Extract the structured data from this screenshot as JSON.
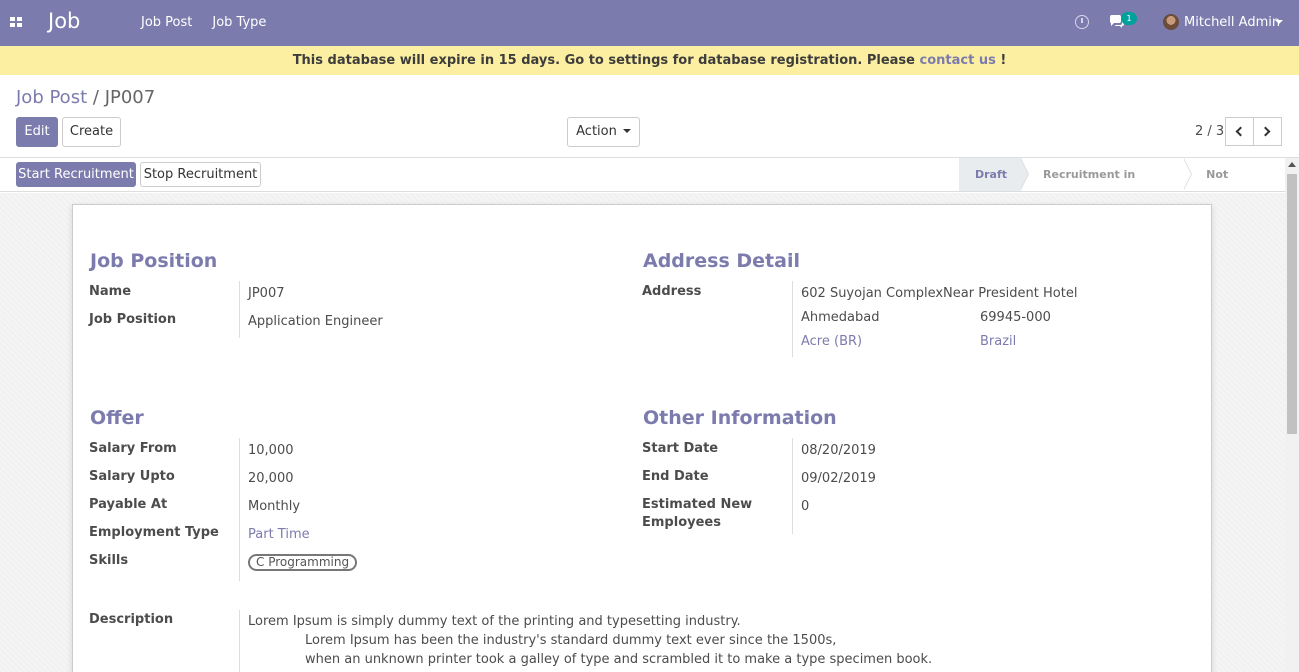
{
  "navbar": {
    "app_title": "Job",
    "menu": [
      "Job Post",
      "Job Type"
    ],
    "chat_count": "1",
    "user_name": "Mitchell Admin"
  },
  "banner": {
    "text": "This database will expire in 15 days. Go to settings for database registration. Please ",
    "link": "contact us",
    "suffix": " !"
  },
  "breadcrumb": {
    "parent": "Job Post",
    "separator": "/",
    "current": "JP007"
  },
  "toolbar": {
    "edit": "Edit",
    "create": "Create",
    "action": "Action"
  },
  "pager": {
    "value": "2 / 3"
  },
  "statusbar": {
    "buttons": [
      "Start Recruitment",
      "Stop Recruitment"
    ],
    "steps": [
      "Draft",
      "Recruitment in Progress",
      "Not Recruiting"
    ],
    "active_step": "Draft"
  },
  "job_position": {
    "title": "Job Position",
    "fields": [
      {
        "label": "Name",
        "value": "JP007"
      },
      {
        "label": "Job Position",
        "value": "Application Engineer"
      }
    ]
  },
  "address": {
    "title": "Address Detail",
    "label": "Address",
    "street": "602 Suyojan ComplexNear President Hotel",
    "city": "Ahmedabad",
    "zip": "69945-000",
    "state": "Acre (BR)",
    "country": "Brazil"
  },
  "offer": {
    "title": "Offer",
    "fields": [
      {
        "label": "Salary From",
        "value": "10,000"
      },
      {
        "label": "Salary Upto",
        "value": "20,000"
      },
      {
        "label": "Payable At",
        "value": "Monthly"
      },
      {
        "label": "Employment Type",
        "value": "Part Time"
      },
      {
        "label": "Skills",
        "value": "C Programming"
      }
    ]
  },
  "other_info": {
    "title": "Other Information",
    "fields": [
      {
        "label": "Start Date",
        "value": "08/20/2019"
      },
      {
        "label": "End Date",
        "value": "09/02/2019"
      },
      {
        "label_line1": "Estimated New",
        "label_line2": "Employees",
        "value": "0"
      }
    ]
  },
  "description": {
    "label": "Description",
    "lines": [
      "Lorem Ipsum is simply dummy text of the printing and typesetting industry.",
      "Lorem Ipsum has been the industry's standard dummy text ever since the 1500s,",
      "when an unknown printer took a galley of type and scrambled it to make a type specimen book."
    ]
  },
  "colors": {
    "brand": "#7c7bad",
    "banner": "#fcefa1",
    "badge": "#00a09d"
  }
}
